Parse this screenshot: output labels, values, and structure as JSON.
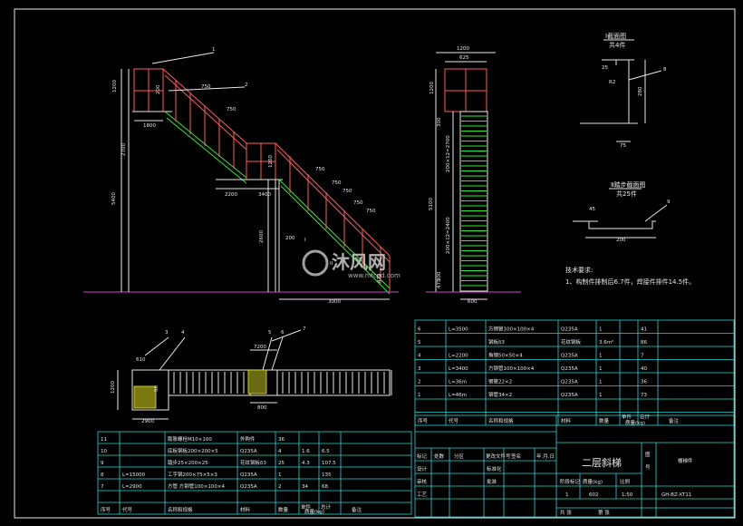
{
  "colors": {
    "background": "#000000",
    "frame": "#e8e8e8",
    "table": "#22d6d6",
    "rail": "#ff5a5a",
    "tread": "#35e835",
    "hatch": "#e8e83a",
    "ground": "#c84bc8"
  },
  "side_view": {
    "balloons": [
      "1",
      "2"
    ],
    "dims": {
      "top_height": "1200",
      "top_inner": "200",
      "stair_w1": "750",
      "stair_w2": "750",
      "top_width": "1800",
      "mid_height": "2700",
      "total_height": "5400",
      "landing_width": "2200",
      "landing_w2": "3400",
      "landing_h": "1200",
      "low_w1": "750",
      "low_w2": "750",
      "low_w3": "750",
      "low_w4": "750",
      "low_w5": "750",
      "low_h": "2600",
      "bottom_width": "3000",
      "low_inner": "200",
      "base_h": "475"
    },
    "section_marks": [
      "I",
      "II"
    ]
  },
  "front_view": {
    "dims": {
      "top": "1200",
      "inner": "625",
      "top_h": "1200",
      "seg1": "200×12=2700",
      "seg2": "200×12=2400",
      "total": "5100",
      "side1": "300",
      "side2": "300",
      "bottom_w": "600",
      "base": "475"
    }
  },
  "section_views": {
    "section1": {
      "title": "Ⅰ截面图",
      "sub": "共4件",
      "dims": {
        "a": "25",
        "b": "280",
        "c": "75"
      },
      "angle": "R2",
      "balloon": "8"
    },
    "section2": {
      "title": "Ⅱ踏步截面图",
      "sub": "共25件",
      "dims": {
        "a": "45",
        "b": "200"
      },
      "balloon": "9"
    }
  },
  "tech_req": {
    "title": "技术要求:",
    "line1": "1、构制件排制后6.7件，焊接件排件14.5件。"
  },
  "watermark": {
    "brand": "沐风网",
    "url": "www.mfcad.com"
  },
  "plan_view": {
    "balloons": [
      "3",
      "4",
      "5",
      "6",
      "7"
    ],
    "dims": {
      "left_w": "610",
      "left_h": "1200",
      "left_bottom": "2900",
      "mid_top": "7200",
      "mid_w": "800",
      "left_s": "50"
    }
  },
  "parts_right": {
    "headers": {
      "no": "序号",
      "code": "代号",
      "name": "名称和规格",
      "material": "材料",
      "qty": "数量",
      "unit_w": "单件",
      "total_w": "总计",
      "weight": "质量(kg)",
      "remark": "备注"
    },
    "rows": [
      {
        "no": "6",
        "code": "L=3500",
        "name": "方钢管100×100×4",
        "material": "Q235A",
        "qty": "1",
        "unit": "",
        "total": "41"
      },
      {
        "no": "5",
        "code": "",
        "name": "钢板δ3",
        "material": "花纹钢板",
        "qty": "3.6m²",
        "unit": "",
        "total": "86"
      },
      {
        "no": "4",
        "code": "L=2200",
        "name": "角钢50×50×4",
        "material": "Q235A",
        "qty": "1",
        "unit": "",
        "total": "7"
      },
      {
        "no": "3",
        "code": "L=3400",
        "name": "方钢管100×100×4",
        "material": "Q235A",
        "qty": "1",
        "unit": "",
        "total": "40"
      },
      {
        "no": "2",
        "code": "L=36m",
        "name": "钢管22×2",
        "material": "Q235A",
        "qty": "1",
        "unit": "",
        "total": "36"
      },
      {
        "no": "1",
        "code": "L=46m",
        "name": "钢管34×2",
        "material": "Q235A",
        "qty": "1",
        "unit": "",
        "total": "73"
      }
    ]
  },
  "parts_left": {
    "headers": {
      "no": "序号",
      "code": "代号",
      "name": "名称和规格",
      "material": "材料",
      "qty": "数量",
      "unit_w": "单件",
      "total_w": "总计",
      "weight": "质量(kg)",
      "remark": "备注"
    },
    "rows": [
      {
        "no": "11",
        "code": "",
        "name": "膨胀螺栓M10×100",
        "material": "外购件",
        "qty": "36",
        "unit": "",
        "total": ""
      },
      {
        "no": "10",
        "code": "",
        "name": "底板钢板200×200×5",
        "material": "Q235A",
        "qty": "4",
        "unit": "1.6",
        "total": "6.5"
      },
      {
        "no": "9",
        "code": "",
        "name": "踏步25×200×25",
        "material": "花纹钢板δ3",
        "qty": "25",
        "unit": "4.3",
        "total": "107.5"
      },
      {
        "no": "8",
        "code": "L=15000",
        "name": "工字钢200×75×5×3",
        "material": "Q235A",
        "qty": "1",
        "unit": "",
        "total": "135"
      },
      {
        "no": "7",
        "code": "L=2900",
        "name": "方管  方钢管100×100×4",
        "material": "Q235A",
        "qty": "2",
        "unit": "34",
        "total": "68"
      }
    ]
  },
  "title_block": {
    "project": "二层斜梯",
    "drawing_no": "GH-BZ-XT11",
    "scale": "1:50",
    "weight": "602",
    "sheet": "1",
    "labels": {
      "mark": "标记",
      "count": "处数",
      "zone": "分区",
      "change_doc": "更改文件号",
      "sign": "签名",
      "date": "年.月.日",
      "designer": "设计",
      "standard": "标准化",
      "stage_mark": "阶段标记",
      "weight_lbl": "质量(kg)",
      "scale_lbl": "比例",
      "review": "审核",
      "craft": "工艺",
      "approve": "批准",
      "sheets_total": "共 张",
      "sheet_no": "第 张",
      "company": "编制",
      "side": "图",
      "side2": "号",
      "side_name": "楼梯件"
    }
  }
}
